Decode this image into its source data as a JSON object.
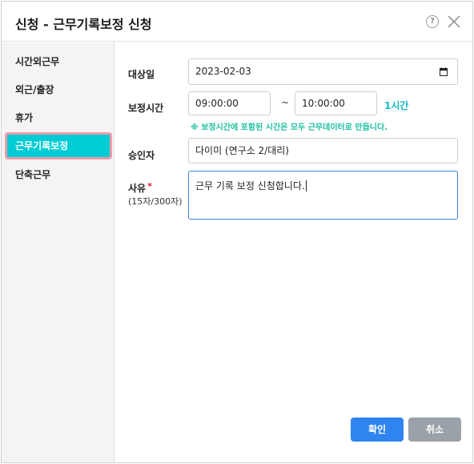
{
  "header": {
    "title": "신청 - 근무기록보정 신청",
    "help_symbol": "?"
  },
  "sidebar": {
    "items": [
      {
        "label": "시간외근무",
        "active": false
      },
      {
        "label": "외근/출장",
        "active": false
      },
      {
        "label": "휴가",
        "active": false
      },
      {
        "label": "근무기록보정",
        "active": true
      },
      {
        "label": "단축근무",
        "active": false
      }
    ]
  },
  "form": {
    "target_date": {
      "label": "대상일",
      "value": "2023-02-03"
    },
    "correction_time": {
      "label": "보정시간",
      "start": "09:00:00",
      "separator": "~",
      "end": "10:00:00",
      "duration": "1시간",
      "note": "※ 보정시간에 포함된 시간은 모두 근무데이터로 만듭니다."
    },
    "approver": {
      "label": "승인자",
      "value": "다이미 (연구소 2/대리)"
    },
    "reason": {
      "label": "사유",
      "required_mark": "*",
      "counter": "(15자/300자)",
      "value": "근무 기록 보정 신청합니다."
    }
  },
  "footer": {
    "confirm_label": "확인",
    "cancel_label": "취소"
  },
  "colors": {
    "active_tab": "#00ccd6",
    "active_tab_border": "#f09aaa",
    "confirm": "#2f84f0",
    "cancel": "#9aa1a8",
    "duration": "#14b8c4",
    "note": "#1fc0a0"
  }
}
